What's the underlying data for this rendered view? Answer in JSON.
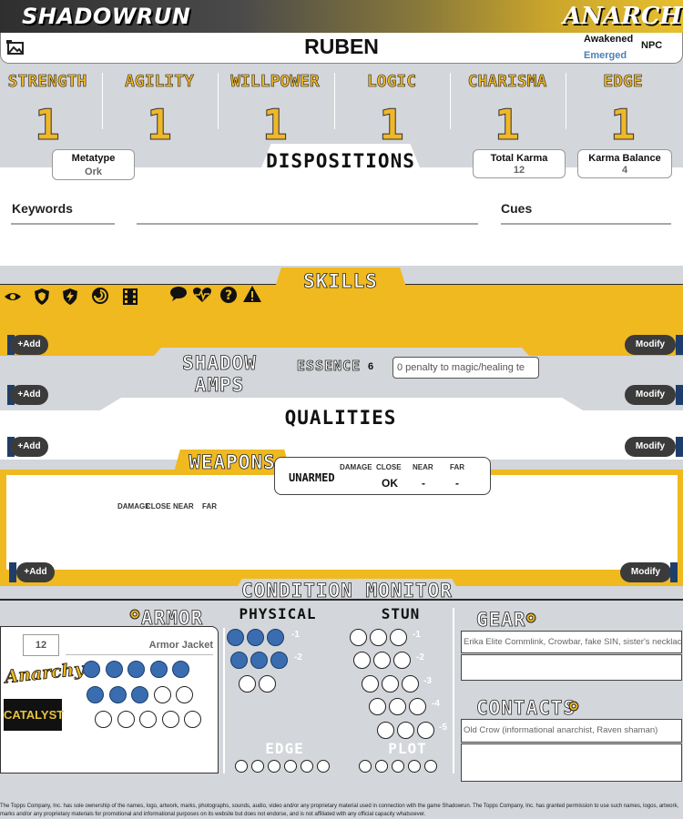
{
  "header": {
    "logo_left": "SHADOWRUN",
    "logo_right": "ANARCHY"
  },
  "character": {
    "name": "RUBEN",
    "awakened": "Awakened",
    "emerged": "Emerged",
    "npc": "NPC"
  },
  "attributes": [
    {
      "label": "STRENGTH",
      "value": "1"
    },
    {
      "label": "AGILITY",
      "value": "1"
    },
    {
      "label": "WILLPOWER",
      "value": "1"
    },
    {
      "label": "LOGIC",
      "value": "1"
    },
    {
      "label": "CHARISMA",
      "value": "1"
    },
    {
      "label": "EDGE",
      "value": "1"
    }
  ],
  "metatype": {
    "label": "Metatype",
    "value": "Ork"
  },
  "karma": {
    "total_label": "Total Karma",
    "total": "12",
    "balance_label": "Karma Balance",
    "balance": "4"
  },
  "dispositions": {
    "title": "DISPOSITIONS",
    "keywords": "Keywords",
    "cues": "Cues"
  },
  "skills": {
    "title": "SKILLS",
    "add": "+Add",
    "modify": "Modify",
    "icons": [
      "eye-icon",
      "shield-icon",
      "lightning-shield-icon",
      "swirl-icon",
      "film-icon",
      "speech-bubble-icon",
      "heartbeat-icon",
      "question-icon",
      "warning-icon"
    ]
  },
  "shadow_amps": {
    "title": "SHADOW AMPS",
    "essence_label": "ESSENCE",
    "essence": "6",
    "penalty": "0 penalty to magic/healing te",
    "add": "+Add",
    "modify": "Modify"
  },
  "qualities": {
    "title": "QUALITIES",
    "add": "+Add",
    "modify": "Modify"
  },
  "weapons": {
    "title": "WEAPONS",
    "unarmed": {
      "name": "UNARMED",
      "damage_label": "DAMAGE",
      "close_label": "CLOSE",
      "near_label": "NEAR",
      "far_label": "FAR",
      "close": "OK",
      "near": "-",
      "far": "-"
    },
    "list_headers": {
      "damage": "DAMAGE",
      "close": "CLOSE",
      "near": "NEAR",
      "far": "FAR"
    },
    "add": "+Add",
    "modify": "Modify"
  },
  "condition": {
    "title": "CONDITION MONITOR",
    "armor_label": "ARMOR",
    "armor_value": "12",
    "armor_name": "Armor Jacket",
    "physical_label": "PHYSICAL",
    "stun_label": "STUN",
    "physical_mods": [
      "-1",
      "-2"
    ],
    "stun_mods": [
      "-1",
      "-2",
      "-3",
      "-4",
      "-5"
    ],
    "edge_label": "EDGE",
    "plot_label": "PLOT",
    "gear_label": "GEAR",
    "gear": "Erika Elite Commlink, Crowbar, fake SIN, sister's necklace",
    "contacts_label": "CONTACTS",
    "contacts": "Old Crow (informational anarchist, Raven shaman)",
    "badge_anarchy": "Anarchy",
    "badge_catalyst": "CATALYST"
  },
  "footer": "The Topps Company, Inc. has sole ownership of the names, logo, artwork, marks, photographs, sounds, audio, video and/or any proprietary material used in connection with the game Shadowrun. The Topps Company, Inc. has granted permission to use such names, logos, artwork, marks and/or any proprietary materials for promotional and informational purposes on its website but does not endorse, and is not affiliated with any official capacity whatsoever."
}
